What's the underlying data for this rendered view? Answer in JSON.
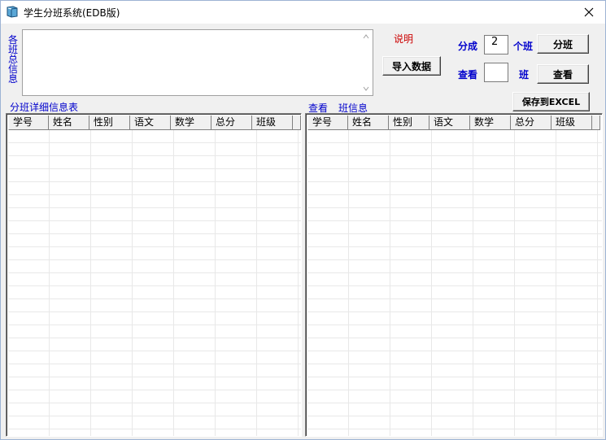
{
  "window": {
    "title": "学生分班系统(EDB版)"
  },
  "info": {
    "label_chars": [
      "各",
      "班",
      "总",
      "信",
      "息"
    ],
    "content": ""
  },
  "explain_link": "说明",
  "buttons": {
    "import": "导入数据",
    "split": "分班",
    "view": "查看",
    "save": "保存到EXCEL"
  },
  "controls": {
    "split_prefix": "分成",
    "split_suffix": "个班",
    "split_value": "2",
    "view_prefix": "查看",
    "view_suffix": "班",
    "view_value": ""
  },
  "left_table": {
    "title": "分班详细信息表",
    "columns": [
      "学号",
      "姓名",
      "性别",
      "语文",
      "数学",
      "总分",
      "班级"
    ]
  },
  "right_table": {
    "title_a": "查看",
    "title_b": "班信息",
    "columns": [
      "学号",
      "姓名",
      "性别",
      "语文",
      "数学",
      "总分",
      "班级"
    ]
  },
  "colors": {
    "label_blue": "#0000cc",
    "link_red": "#cc0000",
    "grid_line": "#e8e8e8"
  }
}
